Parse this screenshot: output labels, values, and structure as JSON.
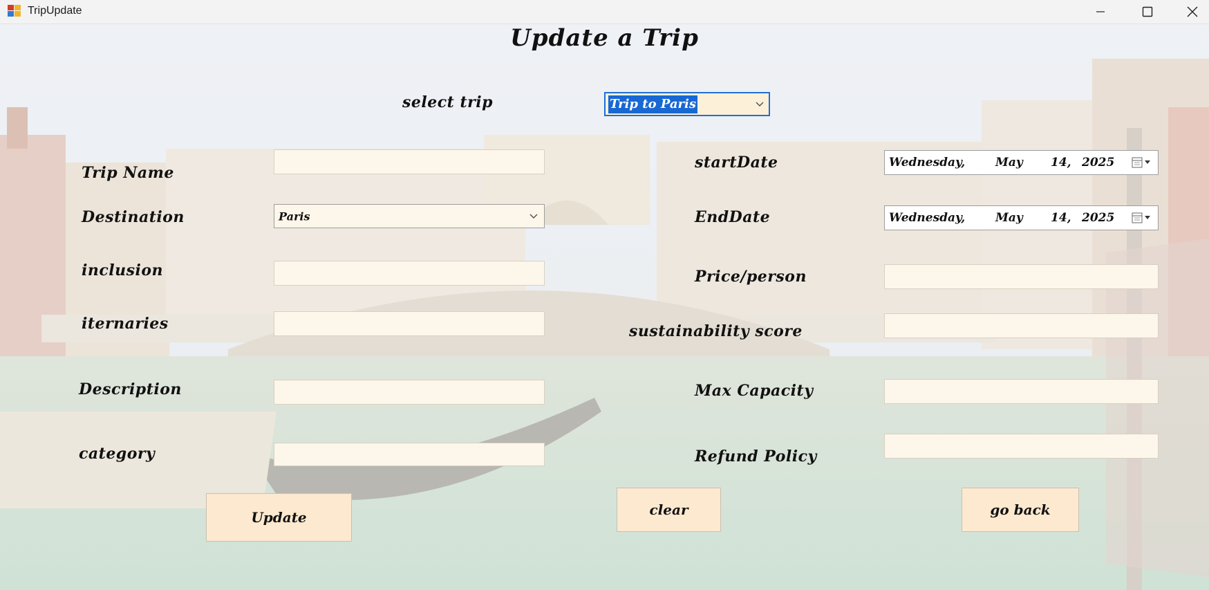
{
  "window": {
    "title": "TripUpdate",
    "icons": {
      "app": "app-icon",
      "minimize": "minimize-icon",
      "maximize": "maximize-icon",
      "close": "close-icon"
    }
  },
  "page": {
    "heading": "Update a Trip"
  },
  "select_trip": {
    "label": "select trip",
    "selected_value": "Trip to Paris",
    "icon": "chevron-down-icon"
  },
  "form": {
    "trip_name": {
      "label": "Trip Name",
      "value": ""
    },
    "destination": {
      "label": "Destination",
      "value": "Paris",
      "icon": "chevron-down-icon"
    },
    "inclusion": {
      "label": "inclusion",
      "value": ""
    },
    "iternaries": {
      "label": "iternaries",
      "value": ""
    },
    "description": {
      "label": "Description",
      "value": ""
    },
    "category": {
      "label": "category",
      "value": ""
    },
    "start_date": {
      "label": "startDate",
      "weekday": "Wednesday,",
      "month": "May",
      "day": "14,",
      "year": "2025",
      "icon": "calendar-icon"
    },
    "end_date": {
      "label": "EndDate",
      "weekday": "Wednesday,",
      "month": "May",
      "day": "14,",
      "year": "2025",
      "icon": "calendar-icon"
    },
    "price_per_person": {
      "label": "Price/person",
      "value": ""
    },
    "sustainability_score": {
      "label": "sustainability score",
      "value": ""
    },
    "max_capacity": {
      "label": "Max Capacity",
      "value": ""
    },
    "refund_policy": {
      "label": "Refund Policy",
      "value": ""
    }
  },
  "buttons": {
    "update": "Update",
    "clear": "clear",
    "go_back": "go back"
  },
  "colors": {
    "field_bg": "#fdf6ea",
    "button_bg": "#fde9cf",
    "selection": "#1868d3",
    "focus_border": "#1f6fd6"
  }
}
